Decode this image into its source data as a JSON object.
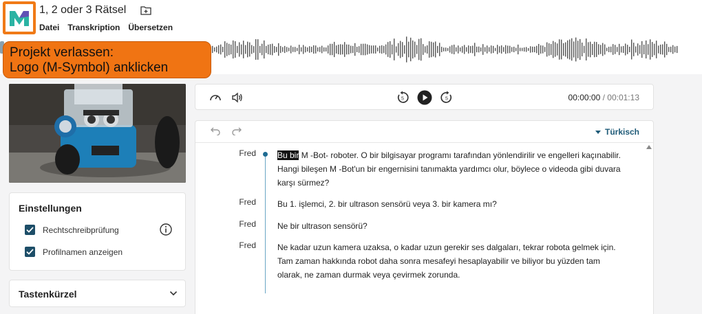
{
  "project": {
    "title": "1, 2 oder 3 Rätsel"
  },
  "menu": {
    "file": "Datei",
    "transcription": "Transkription",
    "translate": "Übersetzen"
  },
  "callout": {
    "line1": "Projekt verlassen:",
    "line2": "Logo (M-Symbol) anklicken"
  },
  "settings": {
    "title": "Einstellungen",
    "spellcheck": "Rechtschreibprüfung",
    "show_profile_names": "Profilnamen anzeigen",
    "spellcheck_checked": true,
    "profile_checked": true
  },
  "shortcuts": {
    "title": "Tastenkürzel"
  },
  "player": {
    "current_time": "00:00:00",
    "separator": " / ",
    "total_time": "00:01:13"
  },
  "editor": {
    "language": "Türkisch"
  },
  "segments": [
    {
      "speaker": "Fred",
      "highlight": "Bu bir",
      "text": " M -Bot- roboter. O bir bilgisayar programı tarafından yönlendirilir ve engelleri kaçınabilir. Hangi bileşen M -Bot'un bir engernisini tanımakta yardımcı olur, böylece o videoda gibi duvara karşı sürmez?"
    },
    {
      "speaker": "Fred",
      "text": "Bu 1. işlemci, 2. bir ultrason sensörü veya 3. bir kamera mı?"
    },
    {
      "speaker": "Fred",
      "text": "Ne bir ultrason sensörü?"
    },
    {
      "speaker": "Fred",
      "text": "Ne kadar uzun kamera uzaksa, o kadar uzun gerekir ses dalgaları, tekrar robota gelmek için. Tam zaman hakkında robot daha sonra mesafeyi hesaplayabilir ve biliyor bu yüzden tam olarak, ne zaman durmak veya çevirmek zorunda."
    }
  ],
  "colors": {
    "accent": "#f07413",
    "primary": "#1d4e68",
    "brand_teal": "#2bb3a3"
  }
}
